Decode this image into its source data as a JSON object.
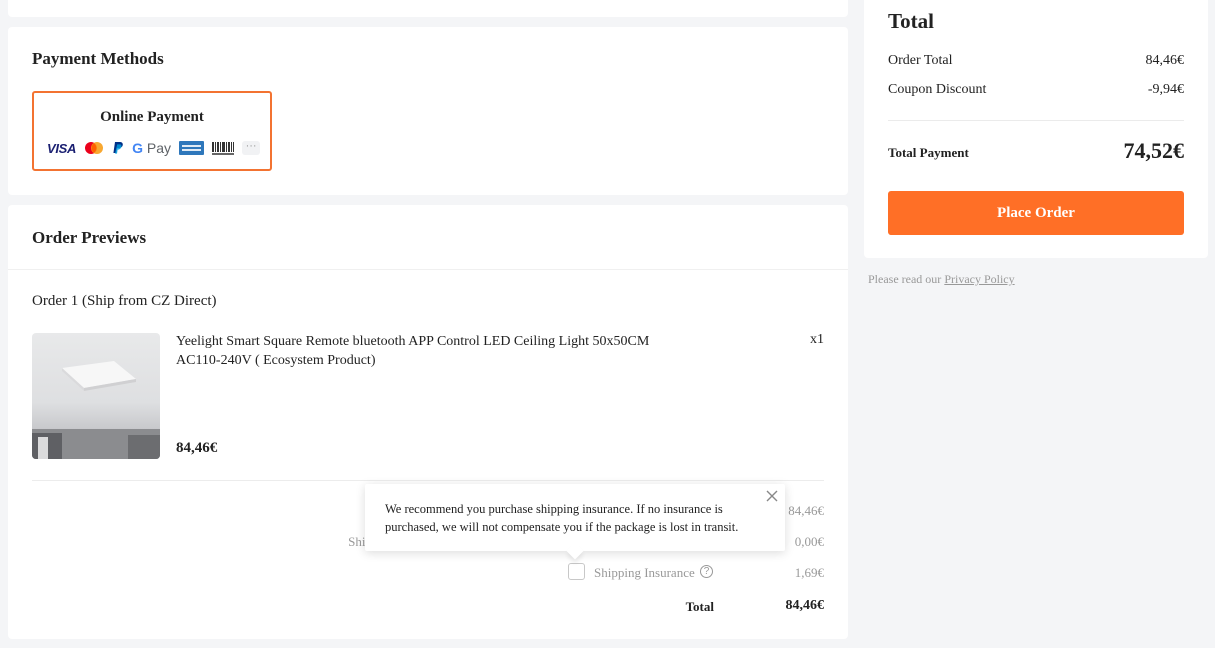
{
  "payment": {
    "title": "Payment Methods",
    "option_label": "Online Payment",
    "brands": {
      "visa": "VISA",
      "gpay_g": "G",
      "gpay_text": " Pay",
      "more": "···"
    },
    "accent_color": "#f37331"
  },
  "previews": {
    "title": "Order Previews",
    "order_heading": "Order 1 (Ship from CZ Direct)",
    "product": {
      "name": "Yeelight Smart Square Remote bluetooth APP Control LED Ceiling Light 50x50CM AC110-240V ( Ecosystem Product)",
      "qty": "x1",
      "price": "84,46€"
    },
    "summary": {
      "subtotal_value": "84,46€",
      "shipping_label": "Ship",
      "shipping_value": "0,00€",
      "insurance_label": "Shipping Insurance",
      "insurance_help": "?",
      "insurance_value": "1,69€",
      "insurance_checked": false,
      "total_label": "Total",
      "total_value": "84,46€"
    }
  },
  "tooltip": {
    "text": "We recommend you purchase shipping insurance. If no insurance is purchased, we will not compensate you if the package is lost in transit."
  },
  "totals": {
    "title": "Total",
    "order_total_label": "Order Total",
    "order_total_value": "84,46€",
    "coupon_label": "Coupon Discount",
    "coupon_value": "-9,94€",
    "total_payment_label": "Total Payment",
    "total_payment_value": "74,52€",
    "place_order_label": "Place Order",
    "button_color": "#ff6f26"
  },
  "privacy": {
    "prefix": "Please read our ",
    "link": "Privacy Policy"
  }
}
